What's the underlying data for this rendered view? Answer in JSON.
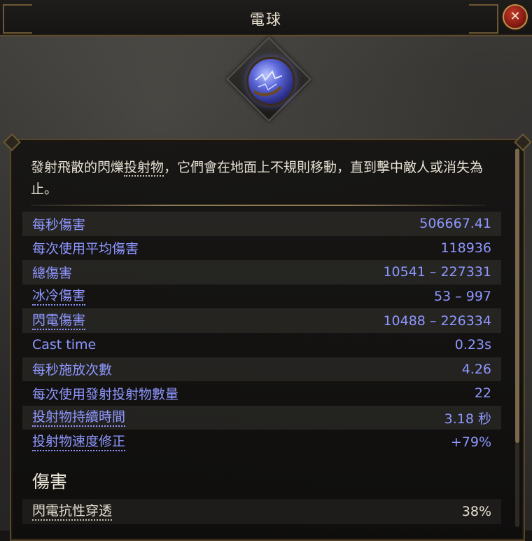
{
  "window": {
    "title": "電球",
    "close_label": "✕"
  },
  "skill": {
    "icon": "lightning-orb-icon",
    "description_pre": "發射飛散的閃爍",
    "description_keyword": "投射物",
    "description_post": "，它們會在地面上不規則移動，直到擊中敵人或消失為止。"
  },
  "stats": [
    {
      "label": "每秒傷害",
      "value": "506667.41",
      "dotted": false
    },
    {
      "label": "每次使用平均傷害",
      "value": "118936",
      "dotted": false
    },
    {
      "label": "總傷害",
      "value": "10541 – 227331",
      "dotted": false
    },
    {
      "label": "冰冷傷害",
      "value": "53 – 997",
      "dotted": true
    },
    {
      "label": "閃電傷害",
      "value": "10488 – 226334",
      "dotted": true
    },
    {
      "label": "Cast time",
      "value": "0.23s",
      "dotted": false
    },
    {
      "label": "每秒施放次數",
      "value": "4.26",
      "dotted": false
    },
    {
      "label": "每次使用發射投射物數量",
      "value": "22",
      "dotted": false
    },
    {
      "label": "投射物持續時間",
      "value": "3.18 秒",
      "dotted": true
    },
    {
      "label": "投射物速度修正",
      "value": "+79%",
      "dotted": true
    }
  ],
  "damage_section": {
    "title": "傷害",
    "rows": [
      {
        "label": "閃電抗性穿透",
        "value": "38%"
      }
    ]
  },
  "colors": {
    "stat_text": "#8f97ff",
    "frame_gold": "#6b5834",
    "close_red": "#c43a2a"
  }
}
